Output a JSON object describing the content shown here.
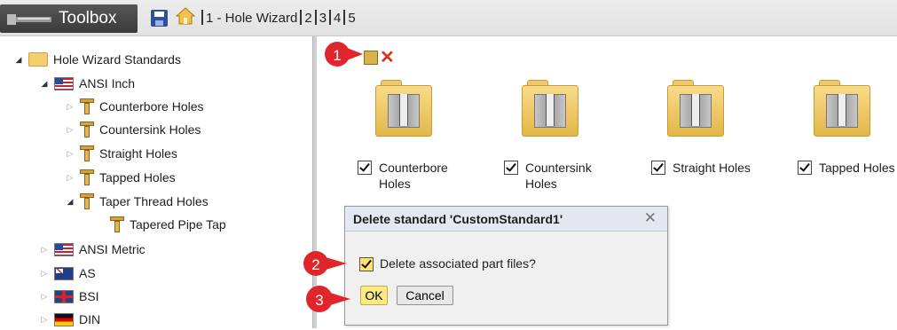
{
  "header": {
    "app_title": "Toolbox",
    "breadcrumb": [
      "1 - Hole Wizard",
      "2",
      "3",
      "4",
      "5"
    ]
  },
  "tree": {
    "root": "Hole Wizard Standards",
    "standard": "ANSI Inch",
    "types": [
      "Counterbore Holes",
      "Countersink Holes",
      "Straight Holes",
      "Tapped Holes",
      "Taper Thread Holes"
    ],
    "subtype": "Tapered Pipe Tap",
    "others": [
      "ANSI Metric",
      "AS",
      "BSI",
      "DIN"
    ]
  },
  "hole_types": [
    {
      "line1": "Counterbore",
      "line2": "Holes"
    },
    {
      "line1": "Countersink",
      "line2": "Holes"
    },
    {
      "line1": "Straight Holes",
      "line2": ""
    },
    {
      "line1": "Tapped Holes",
      "line2": ""
    }
  ],
  "dialog": {
    "title": "Delete standard 'CustomStandard1'",
    "checkbox_label": "Delete associated part files?",
    "ok": "OK",
    "cancel": "Cancel"
  },
  "callouts": [
    "1",
    "2",
    "3"
  ],
  "colors": {
    "callout": "#e0262a",
    "toolbox_bar": "#474747",
    "ok_button": "#fbe98a"
  }
}
